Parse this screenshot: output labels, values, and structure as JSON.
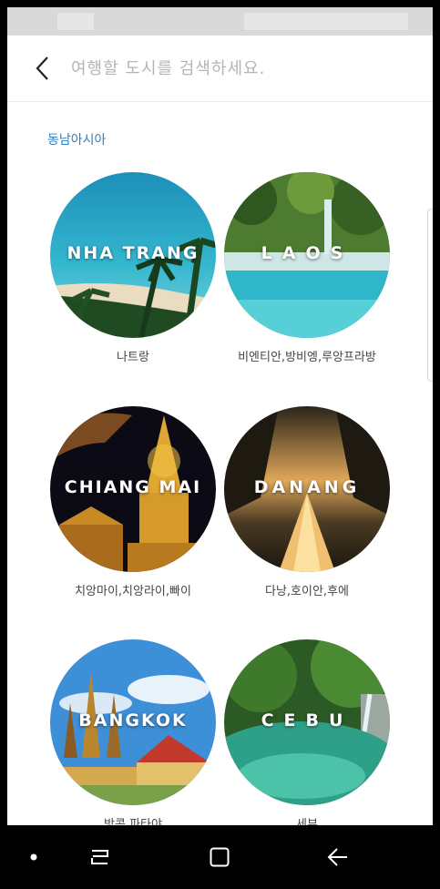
{
  "search": {
    "placeholder": "여행할 도시를 검색하세요."
  },
  "section": {
    "title": "동남아시아"
  },
  "cities": [
    {
      "en": "NHA TRANG",
      "ko": "나트랑"
    },
    {
      "en": "LAOS",
      "ko": "비엔티안,방비엥,루앙프라방"
    },
    {
      "en": "CHIANG MAI",
      "ko": "치앙마이,치앙라이,빠이"
    },
    {
      "en": "DANANG",
      "ko": "다낭,호이안,후에"
    },
    {
      "en": "BANGKOK",
      "ko": "방콕,파타야"
    },
    {
      "en": "CEBU",
      "ko": "세부"
    }
  ],
  "icons": {
    "back": "chevron-left-icon",
    "nav_dot": "dot-icon",
    "nav_recent": "recent-apps-icon",
    "nav_home": "home-icon",
    "nav_back": "back-arrow-icon"
  }
}
